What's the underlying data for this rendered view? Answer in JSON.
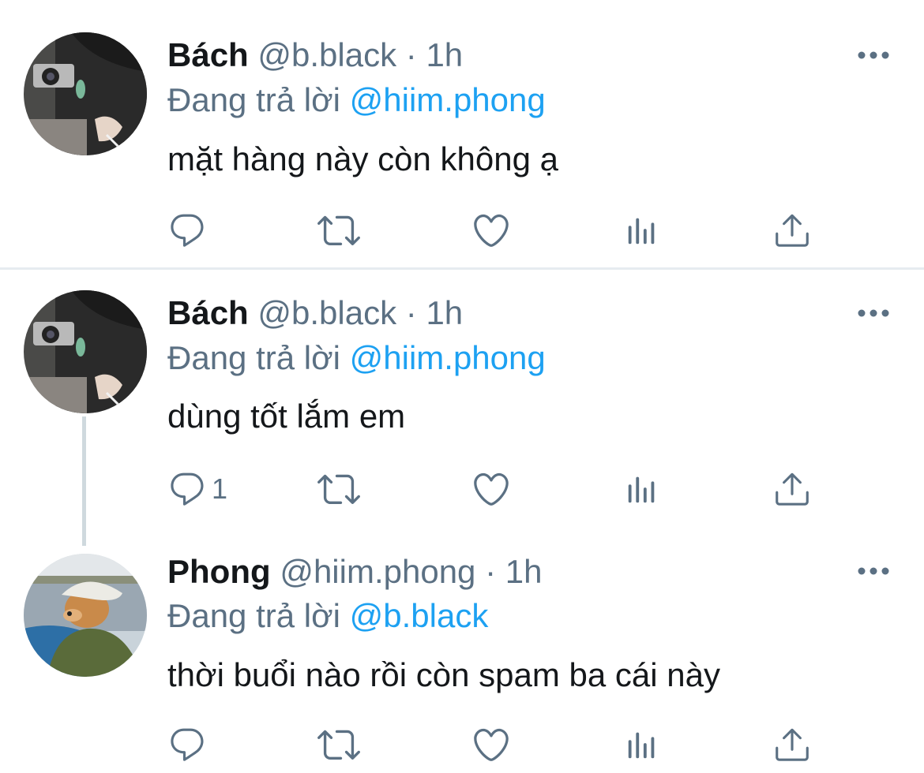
{
  "tweets": [
    {
      "name": "Bách",
      "handle": "@b.black",
      "dot": "·",
      "time": "1h",
      "replying_prefix": "Đang trả lời",
      "replying_to": "@hiim.phong",
      "text": "mặt hàng này còn không ạ",
      "reply_count": ""
    },
    {
      "name": "Bách",
      "handle": "@b.black",
      "dot": "·",
      "time": "1h",
      "replying_prefix": "Đang trả lời",
      "replying_to": "@hiim.phong",
      "text": "dùng tốt lắm em",
      "reply_count": "1"
    },
    {
      "name": "Phong",
      "handle": "@hiim.phong",
      "dot": "·",
      "time": "1h",
      "replying_prefix": "Đang trả lời",
      "replying_to": "@b.black",
      "text": "thời buổi nào rồi còn spam ba cái này",
      "reply_count": ""
    }
  ],
  "icons": {
    "reply": "reply-icon",
    "retweet": "retweet-icon",
    "like": "like-icon",
    "views": "views-icon",
    "share": "share-icon",
    "more": "more-icon"
  },
  "colors": {
    "text_primary": "#14171a",
    "text_secondary": "#5b7083",
    "mention": "#1da1f2",
    "divider": "#e6ecf0"
  }
}
